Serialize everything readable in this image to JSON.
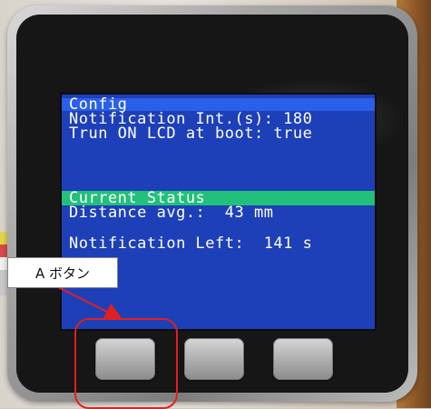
{
  "device": {
    "screen": {
      "config_title": "Config",
      "notification_interval": "Notification Int.(s): 180",
      "lcd_boot": "Trun ON LCD at boot: true",
      "status_title": "Current Status",
      "distance": "Distance avg.:  43 mm",
      "notification_left": "Notification Left:  141 s"
    }
  },
  "annotation": {
    "label": "A ボタン",
    "color": "#e02020"
  },
  "colors": {
    "screen_bg": "#1d3fb8",
    "config_bar": "#2a5fe8",
    "status_bar": "#22c07a"
  }
}
